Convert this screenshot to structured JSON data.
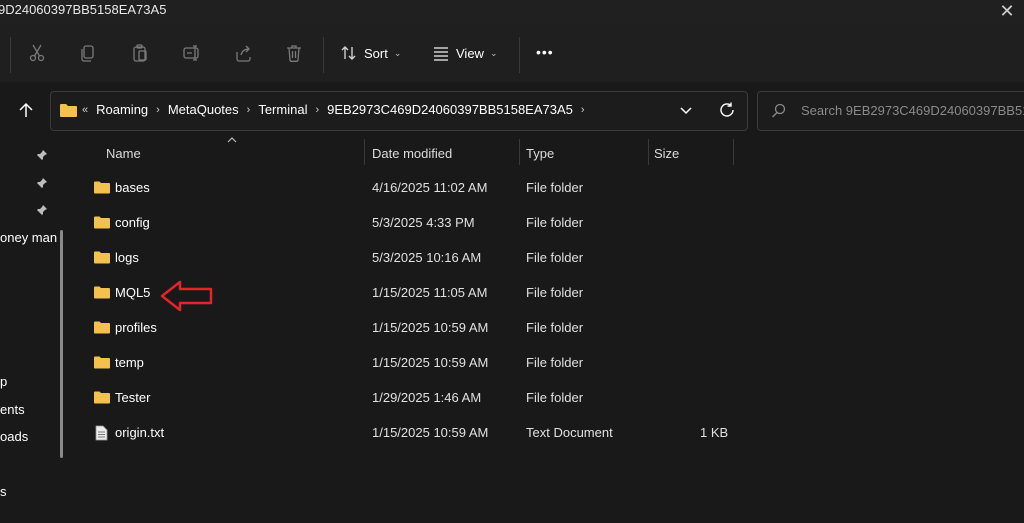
{
  "window": {
    "title": "9D24060397BB5158EA73A5",
    "close_glyph": "✕"
  },
  "toolbar": {
    "sort_label": "Sort",
    "view_label": "View",
    "more_label": "•••"
  },
  "address": {
    "prefix": "«",
    "crumbs": [
      "Roaming",
      "MetaQuotes",
      "Terminal",
      "9EB2973C469D24060397BB5158EA73A5"
    ]
  },
  "search": {
    "placeholder": "Search 9EB2973C469D24060397BB5158"
  },
  "nav": {
    "items": [
      "oney man",
      "p",
      "ents",
      "oads",
      "s"
    ]
  },
  "columns": {
    "name": "Name",
    "date": "Date modified",
    "type": "Type",
    "size": "Size"
  },
  "files": [
    {
      "name": "bases",
      "date": "4/16/2025 11:02 AM",
      "type": "File folder",
      "size": "",
      "icon": "folder-icon"
    },
    {
      "name": "config",
      "date": "5/3/2025 4:33 PM",
      "type": "File folder",
      "size": "",
      "icon": "folder-icon"
    },
    {
      "name": "logs",
      "date": "5/3/2025 10:16 AM",
      "type": "File folder",
      "size": "",
      "icon": "folder-icon"
    },
    {
      "name": "MQL5",
      "date": "1/15/2025 11:05 AM",
      "type": "File folder",
      "size": "",
      "icon": "folder-icon"
    },
    {
      "name": "profiles",
      "date": "1/15/2025 10:59 AM",
      "type": "File folder",
      "size": "",
      "icon": "folder-icon"
    },
    {
      "name": "temp",
      "date": "1/15/2025 10:59 AM",
      "type": "File folder",
      "size": "",
      "icon": "folder-icon"
    },
    {
      "name": "Tester",
      "date": "1/29/2025 1:46 AM",
      "type": "File folder",
      "size": "",
      "icon": "folder-icon"
    },
    {
      "name": "origin.txt",
      "date": "1/15/2025 10:59 AM",
      "type": "Text Document",
      "size": "1 KB",
      "icon": "text-file-icon"
    }
  ],
  "colors": {
    "folder": "#f2c14e",
    "annotation_arrow": "#e3242b",
    "background": "#191919"
  }
}
